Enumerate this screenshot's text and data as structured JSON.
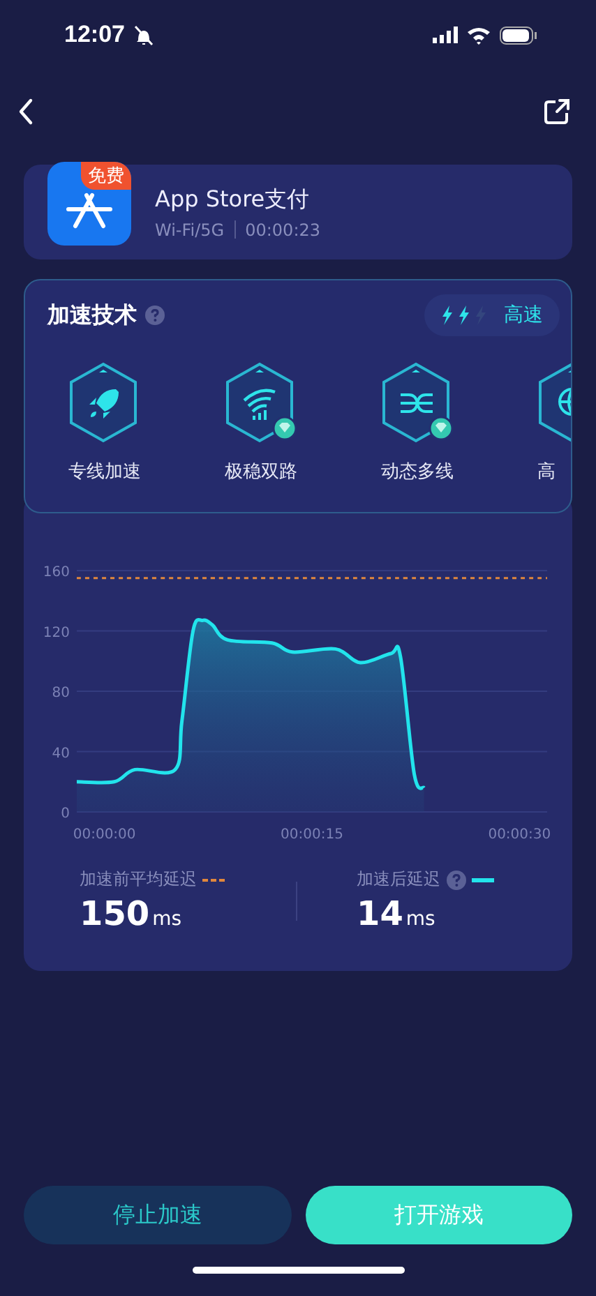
{
  "status_bar": {
    "time": "12:07"
  },
  "app": {
    "name": "App Store支付",
    "badge": "免费",
    "network": "Wi-Fi/5G",
    "duration": "00:00:23"
  },
  "tech": {
    "title": "加速技术",
    "speed_label": "高速",
    "bolts": [
      {
        "on": true
      },
      {
        "on": true
      },
      {
        "on": false
      }
    ],
    "items": [
      {
        "label": "专线加速",
        "kind": "rocket",
        "premium": false
      },
      {
        "label": "极稳双路",
        "kind": "dual",
        "premium": true
      },
      {
        "label": "动态多线",
        "kind": "multi",
        "premium": true
      },
      {
        "label": "高",
        "kind": "globe"
      }
    ]
  },
  "latency": {
    "chart_data": {
      "type": "area",
      "grid": true,
      "x": [
        -2,
        0.7,
        2.2,
        5.1,
        5.6,
        6.4,
        7.1,
        7.8,
        8.9,
        12.1,
        13.6,
        16.7,
        18.5,
        20.7,
        21.4,
        22.4,
        23.1,
        27,
        32
      ],
      "xlim": [
        -2,
        32
      ],
      "ylim": [
        0,
        160
      ],
      "xticks": [
        {
          "value": 0,
          "label": "00:00:00"
        },
        {
          "value": 15,
          "label": "00:00:15"
        },
        {
          "value": 30,
          "label": "00:00:30"
        }
      ],
      "yticks": [
        0,
        40,
        80,
        120,
        160
      ],
      "series": [
        {
          "name": "加速前平均延迟",
          "type": "line",
          "color": "#e0873c",
          "line_style": "dashed",
          "values": [
            155,
            155,
            155,
            155,
            155,
            155,
            155,
            155,
            155,
            155,
            155,
            155,
            155,
            155,
            155,
            155,
            155,
            155,
            155
          ]
        },
        {
          "name": "加速后延迟",
          "type": "area",
          "color": "#22e4ec",
          "line_style": "solid",
          "values": [
            20,
            20,
            28,
            28,
            60,
            120,
            127,
            124,
            114,
            112,
            106,
            108,
            99,
            105,
            103,
            25,
            16,
            null,
            null
          ]
        }
      ]
    },
    "before": {
      "value": "150",
      "unit": "ms"
    },
    "after": {
      "value": "14",
      "unit": "ms"
    }
  },
  "buttons": [
    {
      "label": "停止加速",
      "kind": "secondary"
    },
    {
      "label": "打开游戏",
      "kind": "primary"
    }
  ]
}
